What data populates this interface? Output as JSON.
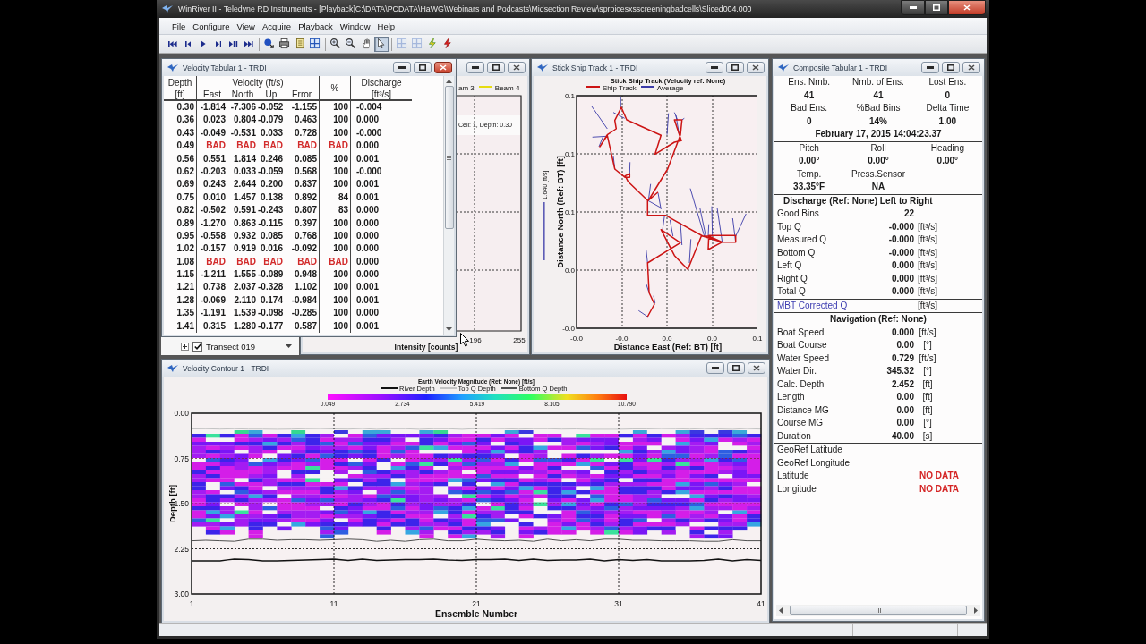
{
  "window": {
    "title": "WinRiver II - Teledyne RD Instruments - [Playback]C:\\DATA\\PCDATA\\HaWG\\Webinars and Podcasts\\Midsection Review\\sproicesxsscreeningbadcells\\Sliced004.000",
    "active": true
  },
  "menu": [
    "File",
    "Configure",
    "View",
    "Acquire",
    "Playback",
    "Window",
    "Help"
  ],
  "toolbar": [
    {
      "buttons": [
        {
          "selected": false,
          "disabled": false
        },
        {
          "selected": false,
          "disabled": false
        },
        {
          "selected": false,
          "disabled": false
        },
        {
          "selected": false,
          "disabled": false
        },
        {
          "selected": false,
          "disabled": false
        },
        {
          "selected": false,
          "disabled": false
        }
      ]
    },
    {
      "buttons": [
        {
          "selected": false,
          "disabled": false
        },
        {
          "selected": false,
          "disabled": false
        },
        {
          "selected": false,
          "disabled": false
        },
        {
          "selected": false,
          "disabled": false
        }
      ]
    },
    {
      "buttons": [
        {
          "selected": false,
          "disabled": false
        },
        {
          "selected": false,
          "disabled": false
        },
        {
          "selected": false,
          "disabled": false
        },
        {
          "selected": true,
          "disabled": false
        }
      ]
    },
    {
      "buttons": [
        {
          "selected": false,
          "disabled": true
        },
        {
          "selected": false,
          "disabled": true
        },
        {
          "selected": false,
          "disabled": false
        },
        {
          "selected": false,
          "disabled": false
        }
      ]
    }
  ],
  "velocity_tabular": {
    "title": "Velocity Tabular 1 - TRDI",
    "active": true,
    "header": {
      "depth": "Depth",
      "velocity": "Velocity (ft/s)",
      "percent": "%",
      "discharge": "Discharge",
      "depth_unit": "[ft]",
      "east": "East",
      "north": "North",
      "up": "Up",
      "error": "Error",
      "discharge_unit": "[ft³/s]"
    },
    "rows": [
      {
        "depth": "0.30",
        "east": "-1.814",
        "north": "-7.306",
        "up": "-0.052",
        "error": "-1.155",
        "percent": "100",
        "discharge": "-0.004",
        "bad": false
      },
      {
        "depth": "0.36",
        "east": "0.023",
        "north": "0.804",
        "up": "-0.079",
        "error": "0.463",
        "percent": "100",
        "discharge": "0.000",
        "bad": false
      },
      {
        "depth": "0.43",
        "east": "-0.049",
        "north": "-0.531",
        "up": "0.033",
        "error": "0.728",
        "percent": "100",
        "discharge": "-0.000",
        "bad": false
      },
      {
        "depth": "0.49",
        "east": "BAD",
        "north": "BAD",
        "up": "BAD",
        "error": "BAD",
        "percent": "BAD",
        "discharge": "0.000",
        "bad": true
      },
      {
        "depth": "0.56",
        "east": "0.551",
        "north": "1.814",
        "up": "0.246",
        "error": "0.085",
        "percent": "100",
        "discharge": "0.001",
        "bad": false
      },
      {
        "depth": "0.62",
        "east": "-0.203",
        "north": "0.033",
        "up": "-0.059",
        "error": "0.568",
        "percent": "100",
        "discharge": "-0.000",
        "bad": false
      },
      {
        "depth": "0.69",
        "east": "0.243",
        "north": "2.644",
        "up": "0.200",
        "error": "0.837",
        "percent": "100",
        "discharge": "0.001",
        "bad": false
      },
      {
        "depth": "0.75",
        "east": "0.010",
        "north": "1.457",
        "up": "0.138",
        "error": "0.892",
        "percent": "84",
        "discharge": "0.001",
        "bad": false
      },
      {
        "depth": "0.82",
        "east": "-0.502",
        "north": "0.591",
        "up": "-0.243",
        "error": "0.807",
        "percent": "83",
        "discharge": "0.000",
        "bad": false
      },
      {
        "depth": "0.89",
        "east": "-1.270",
        "north": "0.863",
        "up": "-0.115",
        "error": "0.397",
        "percent": "100",
        "discharge": "0.000",
        "bad": false
      },
      {
        "depth": "0.95",
        "east": "-0.558",
        "north": "0.932",
        "up": "0.085",
        "error": "0.768",
        "percent": "100",
        "discharge": "0.000",
        "bad": false
      },
      {
        "depth": "1.02",
        "east": "-0.157",
        "north": "0.919",
        "up": "0.016",
        "error": "-0.092",
        "percent": "100",
        "discharge": "0.000",
        "bad": false
      },
      {
        "depth": "1.08",
        "east": "BAD",
        "north": "BAD",
        "up": "BAD",
        "error": "BAD",
        "percent": "BAD",
        "discharge": "0.000",
        "bad": true
      },
      {
        "depth": "1.15",
        "east": "-1.211",
        "north": "1.555",
        "up": "-0.089",
        "error": "0.948",
        "percent": "100",
        "discharge": "0.000",
        "bad": false
      },
      {
        "depth": "1.21",
        "east": "0.738",
        "north": "2.037",
        "up": "-0.328",
        "error": "1.102",
        "percent": "100",
        "discharge": "0.001",
        "bad": false
      },
      {
        "depth": "1.28",
        "east": "-0.069",
        "north": "2.110",
        "up": "0.174",
        "error": "-0.984",
        "percent": "100",
        "discharge": "0.001",
        "bad": false
      },
      {
        "depth": "1.35",
        "east": "-1.191",
        "north": "1.539",
        "up": "-0.098",
        "error": "-0.285",
        "percent": "100",
        "discharge": "0.000",
        "bad": false
      },
      {
        "depth": "1.41",
        "east": "0.315",
        "north": "1.280",
        "up": "-0.177",
        "error": "0.587",
        "percent": "100",
        "discharge": "0.001",
        "bad": false
      }
    ]
  },
  "project_tree": {
    "items": [
      {
        "label": "Transect 019",
        "checked": true,
        "expanded": false
      }
    ]
  },
  "intensity_profile": {
    "active": false,
    "legend": [
      {
        "label": "am 3"
      },
      {
        "label": "Beam 4",
        "color": "#e6dc10"
      }
    ],
    "annotation": "Cell: 1, Depth: 0.30",
    "x_tick_labels": [
      "196",
      "255"
    ],
    "xlabel": "Intensity [counts]"
  },
  "ship_track": {
    "title": "Stick Ship Track 1 - TRDI",
    "active": false,
    "plot_title": "Stick Ship Track (Velocity ref: None)",
    "legend": [
      {
        "label": "Ship Track",
        "color": "#cc1414"
      },
      {
        "label": "Average",
        "color": "#3a3aa8"
      }
    ],
    "scale_label": "1.640 [ft/s]",
    "y_tick_labels": [
      "0.1",
      "0.1",
      "0.1",
      "0.0",
      "-0.0"
    ],
    "x_tick_labels": [
      "-0.0",
      "-0.0",
      "0.0",
      "0.0",
      "0.1"
    ],
    "xlabel": "Distance East (Ref: BT) [ft]",
    "ylabel": "Distance North (Ref: BT) [ft]"
  },
  "velocity_contour": {
    "title": "Velocity Contour 1 - TRDI",
    "active": false,
    "plot_title": "Earth Velocity Magnitude (Ref: None) [ft/s]",
    "legend": [
      {
        "label": "River Depth",
        "color": "#111111"
      },
      {
        "label": "Top Q Depth",
        "color": "#c4c4c4"
      },
      {
        "label": "Bottom Q Depth",
        "color": "#505050"
      }
    ],
    "color_scale_labels": [
      "0.049",
      "2.734",
      "5.419",
      "8.105",
      "10.790"
    ],
    "y_tick_labels": [
      "0.00",
      "0.75",
      "1.50",
      "2.25",
      "3.00"
    ],
    "x_tick_labels": [
      "1",
      "11",
      "21",
      "31",
      "41"
    ],
    "xlabel": "Ensemble Number",
    "ylabel": "Depth [ft]"
  },
  "composite": {
    "title": "Composite Tabular 1 - TRDI",
    "active": false,
    "summary": [
      {
        "label": "Ens. Nmb.",
        "value": "41"
      },
      {
        "label": "Nmb. of Ens.",
        "value": "41"
      },
      {
        "label": "Lost Ens.",
        "value": "0"
      },
      {
        "label": "Bad Ens.",
        "value": "0"
      },
      {
        "label": "%Bad Bins",
        "value": "14%"
      },
      {
        "label": "Delta Time",
        "value": "1.00"
      }
    ],
    "timestamp": "February 17, 2015  14:04:23.37",
    "attitude": [
      {
        "label": "Pitch",
        "value": "0.00°"
      },
      {
        "label": "Roll",
        "value": "0.00°"
      },
      {
        "label": "Heading",
        "value": "0.00°"
      },
      {
        "label": "Temp.",
        "value": "33.35°F"
      },
      {
        "label": "Press.Sensor",
        "value": "NA"
      }
    ],
    "discharge": {
      "heading": "Discharge (Ref: None) Left to Right",
      "rows": [
        {
          "kind": "value",
          "label": "Good Bins",
          "value": "22"
        },
        {
          "kind": "value",
          "label": "Top Q",
          "value": "-0.000",
          "unit": "[ft³/s]"
        },
        {
          "kind": "value",
          "label": "Measured Q",
          "value": "-0.000",
          "unit": "[ft³/s]"
        },
        {
          "kind": "value",
          "label": "Bottom Q",
          "value": "-0.000",
          "unit": "[ft³/s]"
        },
        {
          "kind": "value",
          "label": "Left Q",
          "value": "0.000",
          "unit": "[ft³/s]"
        },
        {
          "kind": "value",
          "label": "Right Q",
          "value": "0.000",
          "unit": "[ft³/s]"
        },
        {
          "kind": "value",
          "label": "Total Q",
          "value": "0.000",
          "unit": "[ft³/s]"
        },
        {
          "kind": "link",
          "label": "MBT Corrected Q",
          "unit": "[ft³/s]"
        }
      ]
    },
    "navigation": {
      "heading": "Navigation (Ref: None)",
      "rows": [
        {
          "label": "Boat Speed",
          "value": "0.000",
          "unit": "[ft/s]"
        },
        {
          "label": "Boat Course",
          "value": "0.00",
          "unit": "[°]"
        },
        {
          "label": "Water Speed",
          "value": "0.729",
          "unit": "[ft/s]"
        },
        {
          "label": "Water Dir.",
          "value": "345.32",
          "unit": "[°]"
        },
        {
          "label": "Calc. Depth",
          "value": "2.452",
          "unit": "[ft]"
        },
        {
          "label": "Length",
          "value": "0.00",
          "unit": "[ft]"
        },
        {
          "label": "Distance MG",
          "value": "0.00",
          "unit": "[ft]"
        },
        {
          "label": "Course MG",
          "value": "0.00",
          "unit": "[°]"
        },
        {
          "label": "Duration",
          "value": "40.00",
          "unit": "[s]"
        }
      ]
    },
    "position": [
      {
        "label": "GeoRef Latitude"
      },
      {
        "label": "GeoRef Longitude"
      },
      {
        "label": "Latitude",
        "value": "NO DATA",
        "alert": true
      },
      {
        "label": "Longitude",
        "value": "NO DATA",
        "alert": true
      }
    ]
  }
}
